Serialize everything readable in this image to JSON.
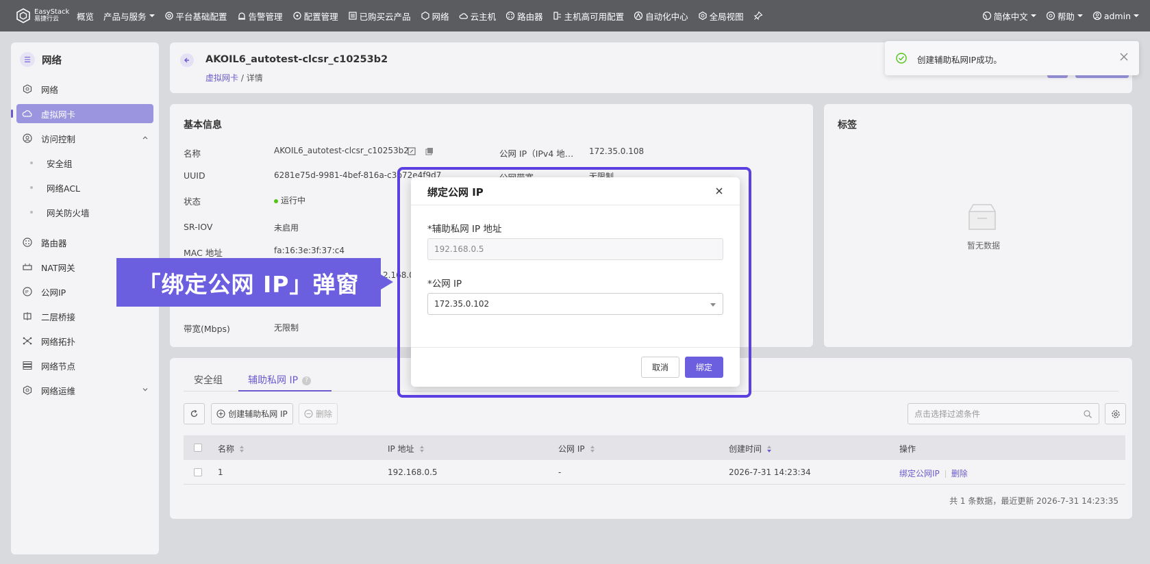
{
  "brand": {
    "line1": "EasyStack",
    "line2": "易捷行云"
  },
  "nav": {
    "items": [
      {
        "label": "概览",
        "icon": ""
      },
      {
        "label": "产品与服务",
        "icon": "",
        "caret": true
      },
      {
        "label": "平台基础配置",
        "icon": "gear-icon"
      },
      {
        "label": "告警管理",
        "icon": "alarm-icon"
      },
      {
        "label": "配置管理",
        "icon": "config-icon"
      },
      {
        "label": "已购买云产品",
        "icon": "list-icon"
      },
      {
        "label": "网络",
        "icon": "network-icon"
      },
      {
        "label": "云主机",
        "icon": "cloud-icon"
      },
      {
        "label": "路由器",
        "icon": "router-icon"
      },
      {
        "label": "主机高可用配置",
        "icon": "ha-icon"
      },
      {
        "label": "自动化中心",
        "icon": "auto-icon"
      },
      {
        "label": "全局视图",
        "icon": "global-icon"
      }
    ],
    "language": "简体中文",
    "help": "帮助",
    "user": "admin"
  },
  "sidebar": {
    "title": "网络",
    "items": [
      {
        "label": "网络"
      },
      {
        "label": "虚拟网卡"
      },
      {
        "label": "访问控制"
      },
      {
        "label": "安全组"
      },
      {
        "label": "网络ACL"
      },
      {
        "label": "网关防火墙"
      },
      {
        "label": "路由器"
      },
      {
        "label": "NAT网关"
      },
      {
        "label": "公网IP"
      },
      {
        "label": "二层桥接"
      },
      {
        "label": "网络拓扑"
      },
      {
        "label": "网络节点"
      },
      {
        "label": "网络运维"
      }
    ]
  },
  "header": {
    "title": "AKOIL6_autotest-clcsr_c10253b2",
    "breadcrumb_link": "虚拟网卡",
    "breadcrumb_current": " / 详情"
  },
  "info": {
    "title": "基本信息",
    "labels": [
      "名称",
      "UUID",
      "状态",
      "SR-IOV",
      "MAC 地址",
      "带宽(Mbps)"
    ],
    "values": {
      "name": "AKOIL6_autotest-clcsr_c10253b2",
      "uuid": "6281e75d-9981-4bef-816a-c3b72",
      "uuid_tail": "e4f9d7",
      "status": "运行中",
      "sriov": "未启用",
      "mac": "fa:16:3e:3f:37:c4",
      "partial_ip": "2.168.0.5",
      "bandwidth": "无限制"
    },
    "right_labels": [
      "公网 IP（IPv4 地…",
      "公网带宽"
    ],
    "right_values": [
      "172.35.0.108",
      "无限制"
    ]
  },
  "tags": {
    "title": "标签",
    "empty": "暂无数据"
  },
  "tabs": {
    "items": [
      "安全组",
      "辅助私网 IP"
    ],
    "help": "?"
  },
  "toolbar": {
    "create": "创建辅助私网 IP",
    "delete": "删除",
    "filter_placeholder": "点击选择过滤条件"
  },
  "table": {
    "headers": [
      "名称",
      "IP 地址",
      "公网 IP",
      "创建时间",
      "操作"
    ],
    "rows": [
      {
        "name": "1",
        "ip": "192.168.0.5",
        "public_ip": "-",
        "created": "2026-7-31 14:23:34",
        "action1": "绑定公网IP",
        "action2": "删除"
      }
    ],
    "footer": "共 1 条数据，最近更新  2026-7-31 14:23:35"
  },
  "toast": {
    "message": "创建辅助私网IP成功。"
  },
  "callout": {
    "text": "「绑定公网 IP」弹窗"
  },
  "modal": {
    "title": "绑定公网 IP",
    "field1_label": "*辅助私网 IP 地址",
    "field1_value": "192.168.0.5",
    "field2_label": "*公网 IP",
    "field2_value": "172.35.0.102",
    "cancel": "取消",
    "confirm": "绑定"
  },
  "colors": {
    "accent": "#6b5fe0",
    "topbar": "#5b5c60",
    "success": "#52c41a"
  }
}
